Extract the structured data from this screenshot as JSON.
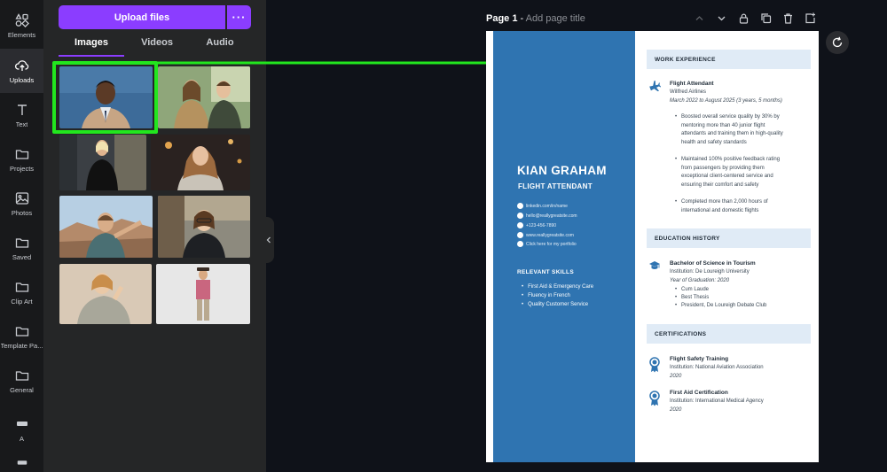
{
  "rail": [
    {
      "label": "Elements",
      "icon": "elements-icon"
    },
    {
      "label": "Uploads",
      "icon": "uploads-icon",
      "active": true
    },
    {
      "label": "Text",
      "icon": "text-icon"
    },
    {
      "label": "Projects",
      "icon": "folder-icon"
    },
    {
      "label": "Photos",
      "icon": "photos-icon"
    },
    {
      "label": "Saved",
      "icon": "folder-icon"
    },
    {
      "label": "Clip Art",
      "icon": "folder-icon"
    },
    {
      "label": "Template Pa...",
      "icon": "folder-icon"
    },
    {
      "label": "General",
      "icon": "folder-icon"
    },
    {
      "label": "A",
      "icon": "app-icon"
    }
  ],
  "panel": {
    "upload_label": "Upload files",
    "more_label": "···",
    "tabs": [
      "Images",
      "Videos",
      "Audio"
    ],
    "active_tab": "Images"
  },
  "page": {
    "number_label": "Page 1",
    "separator": " - ",
    "title_placeholder": "Add page title"
  },
  "resume": {
    "name": "KIAN GRAHAM",
    "role": "FLIGHT ATTENDANT",
    "contacts": [
      "linkedin.com/in/name",
      "hello@reallygreatsite.com",
      "+123-456-7890",
      "www.reallygreatsite.com",
      "Click here for my portfolio"
    ],
    "skills_title": "RELEVANT SKILLS",
    "skills": [
      "First Aid & Emergency Care",
      "Fluency in French",
      "Quality Customer Service"
    ],
    "work_title": "WORK EXPERIENCE",
    "work": {
      "title": "Flight Attendant",
      "company": "Willfred Airlines",
      "dates": "March 2022 to August 2025 (3 years, 5 months)",
      "bullets": [
        "Boosted overall service quality by 30% by mentoring more than 40 junior flight attendants and training them in high-quality health and safety standards",
        "Maintained 100% positive feedback rating from passengers by providing them exceptional client-centered service and ensuring their comfort and safety",
        "Completed more than 2,000 hours of international and domestic flights"
      ]
    },
    "edu_title": "EDUCATION HISTORY",
    "edu": {
      "title": "Bachelor of Science in Tourism",
      "institution": "Institution: De Loureigh University",
      "year": "Year of Graduation: 2020",
      "bullets": [
        "Cum Laude",
        "Best Thesis",
        "President, De Loureigh Debate Club"
      ]
    },
    "cert_title": "CERTIFICATIONS",
    "certs": [
      {
        "title": "Flight Safety Training",
        "institution": "Institution: National Aviation Association",
        "year": "2020"
      },
      {
        "title": "First Aid Certification",
        "institution": "Institution: International Medical Agency",
        "year": "2020"
      }
    ]
  },
  "colors": {
    "accent": "#8b3dff",
    "highlight": "#22e61e",
    "resume_blue": "#2f74b1"
  }
}
